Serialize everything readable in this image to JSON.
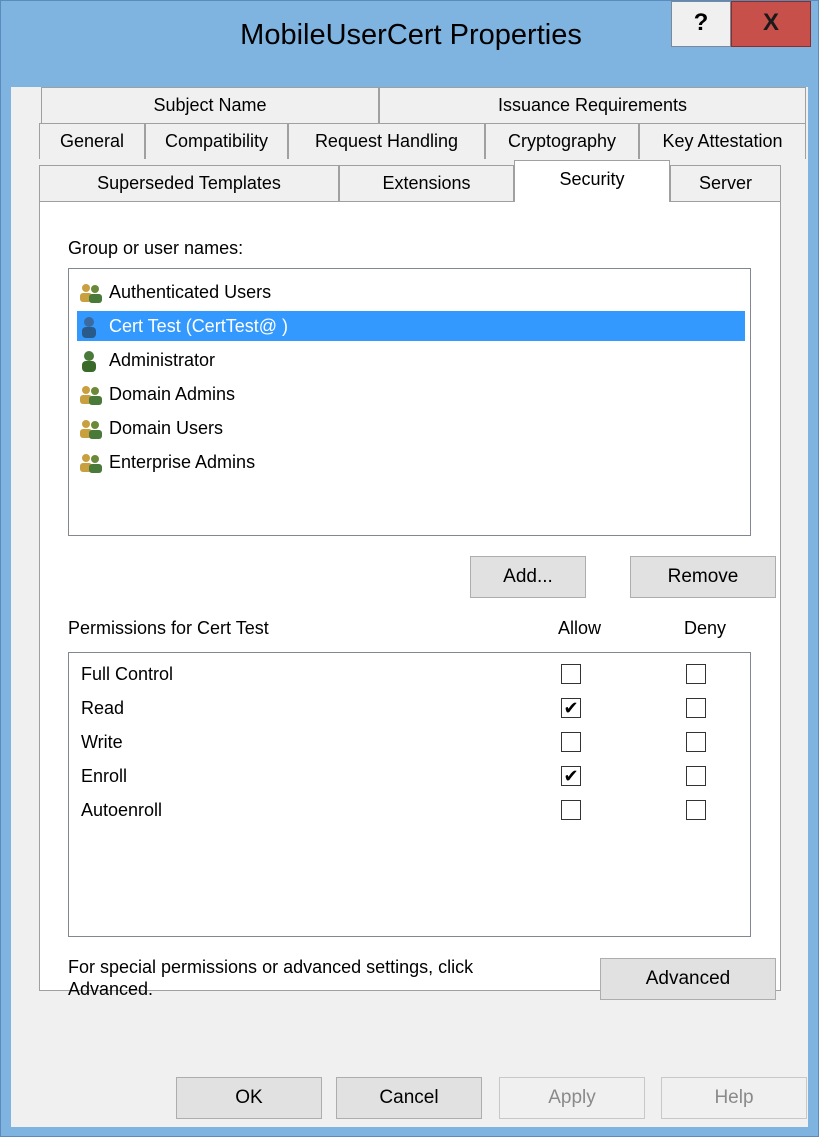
{
  "window": {
    "title": "MobileUserCert Properties",
    "help_label": "?",
    "close_label": "X"
  },
  "tabs": {
    "row1": [
      "Subject Name",
      "Issuance Requirements"
    ],
    "row2": [
      "General",
      "Compatibility",
      "Request Handling",
      "Cryptography",
      "Key Attestation"
    ],
    "row3": [
      "Superseded Templates",
      "Extensions",
      "Security",
      "Server"
    ],
    "active": "Security"
  },
  "security": {
    "group_label": "Group or user names:",
    "users": [
      {
        "name": "Authenticated Users",
        "icon": "group-icon",
        "selected": false
      },
      {
        "name": "Cert Test (CertTest@                )",
        "icon": "user-icon",
        "selected": true
      },
      {
        "name": "Administrator",
        "icon": "user-icon",
        "selected": false
      },
      {
        "name": "Domain Admins",
        "icon": "group-icon",
        "selected": false
      },
      {
        "name": "Domain Users",
        "icon": "group-icon",
        "selected": false
      },
      {
        "name": "Enterprise Admins",
        "icon": "group-icon",
        "selected": false
      }
    ],
    "add_label": "Add...",
    "remove_label": "Remove",
    "permissions_label": "Permissions for Cert Test",
    "allow_header": "Allow",
    "deny_header": "Deny",
    "permissions": [
      {
        "name": "Full Control",
        "allow": false,
        "deny": false
      },
      {
        "name": "Read",
        "allow": true,
        "deny": false
      },
      {
        "name": "Write",
        "allow": false,
        "deny": false
      },
      {
        "name": "Enroll",
        "allow": true,
        "deny": false
      },
      {
        "name": "Autoenroll",
        "allow": false,
        "deny": false
      }
    ],
    "advanced_text_line1": "For special permissions or advanced settings, click",
    "advanced_text_line2": "Advanced.",
    "advanced_label": "Advanced",
    "check_mark": "✔"
  },
  "footer": {
    "ok_label": "OK",
    "cancel_label": "Cancel",
    "apply_label": "Apply",
    "help_label": "Help"
  },
  "colors": {
    "titlebar": "#7fb3e0",
    "selection": "#3399ff",
    "close": "#c7504a"
  }
}
